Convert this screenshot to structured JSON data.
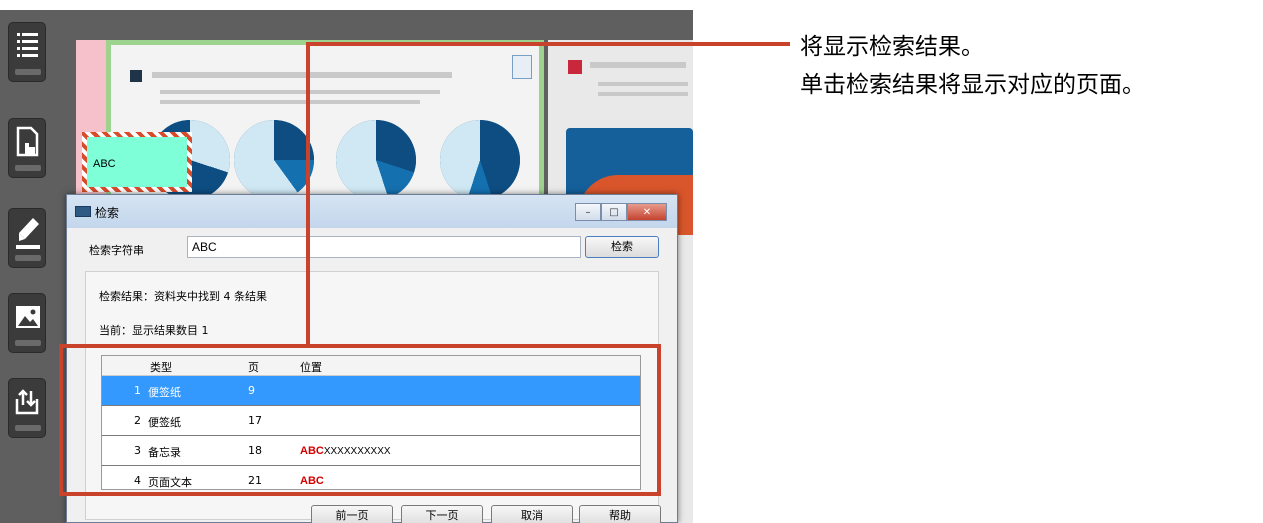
{
  "dialog": {
    "title": "检索",
    "search_label": "检索字符串",
    "search_value": "ABC",
    "search_button": "检索",
    "summary": "检索结果：资料夹中找到 4 条结果",
    "current": "当前：显示结果数目 1",
    "columns": [
      "类型",
      "页",
      "位置"
    ],
    "rows": [
      {
        "index": "1",
        "type": "便签纸",
        "page": "9",
        "pos_hl": "",
        "pos_rest": "",
        "selected": true
      },
      {
        "index": "2",
        "type": "便签纸",
        "page": "17",
        "pos_hl": "",
        "pos_rest": "",
        "selected": false
      },
      {
        "index": "3",
        "type": "备忘录",
        "page": "18",
        "pos_hl": "ABC",
        "pos_rest": "XXXXXXXXXX",
        "selected": false
      },
      {
        "index": "4",
        "type": "页面文本",
        "page": "21",
        "pos_hl": "ABC",
        "pos_rest": "",
        "selected": false
      }
    ],
    "buttons": {
      "prev": "前一页",
      "next": "下一页",
      "cancel": "取消",
      "help": "帮助"
    },
    "window_buttons": {
      "minimize": "–",
      "maximize": "□",
      "close": "✕"
    }
  },
  "note": {
    "text": "ABC"
  },
  "callout": {
    "line1": "将显示检索结果。",
    "line2": "单击检索结果将显示对应的页面。"
  },
  "toolbar": {
    "icons": [
      "list-icon",
      "touch-document-icon",
      "highlighter-icon",
      "image-icon",
      "export-icon"
    ]
  },
  "colors": {
    "callout": "#c9422b",
    "selection": "#3399ff",
    "note": "#7effd8",
    "highlight": "#d40000"
  }
}
